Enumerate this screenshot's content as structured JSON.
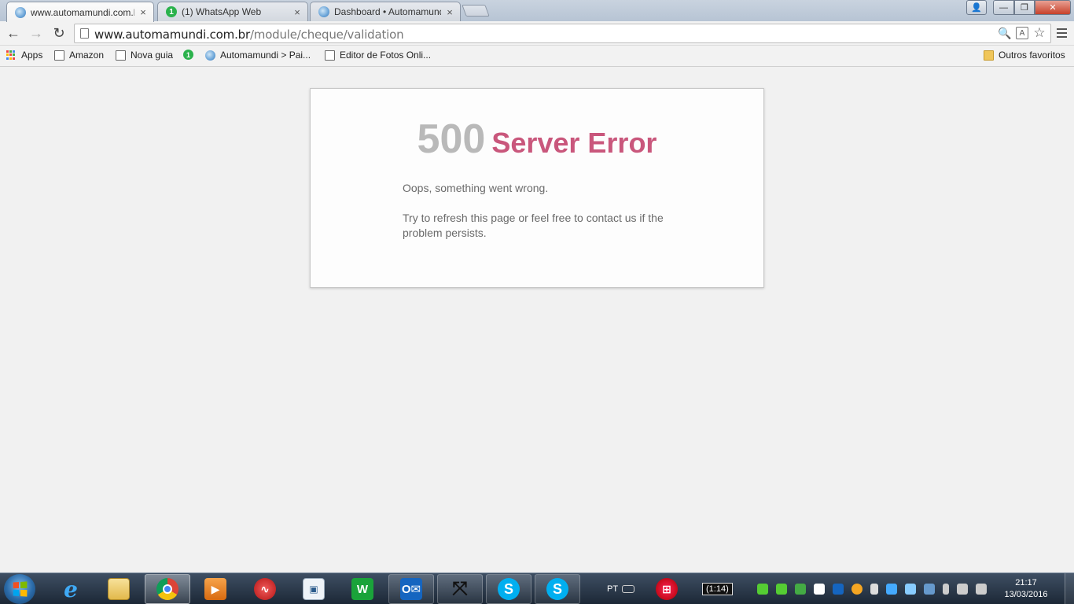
{
  "browser": {
    "tabs": [
      {
        "title": "www.automamundi.com.b",
        "icon": "globe-icon",
        "active": true
      },
      {
        "title": "(1) WhatsApp Web",
        "icon": "whatsapp-icon",
        "badge": "1",
        "active": false
      },
      {
        "title": "Dashboard • Automamund",
        "icon": "globe-icon",
        "active": false
      }
    ],
    "tab_close": "×",
    "window_controls": {
      "minimize": "—",
      "maximize": "❐",
      "close": "✕",
      "user": "👤"
    }
  },
  "toolbar": {
    "back": "←",
    "forward": "→",
    "reload": "↻",
    "url_host": "www.automamundi.com.br",
    "url_path": "/module/cheque/validation",
    "zoom_icon": "🔍",
    "translate_icon": "A",
    "star_icon": "☆"
  },
  "bookmarks": {
    "items": [
      {
        "label": "Apps"
      },
      {
        "label": "Amazon"
      },
      {
        "label": "Nova guia"
      },
      {
        "label": "",
        "badge": "1"
      },
      {
        "label": "Automamundi > Pai..."
      },
      {
        "label": "Editor de Fotos Onli..."
      }
    ],
    "other": "Outros favoritos"
  },
  "error_page": {
    "code": "500",
    "title": "Server Error",
    "message": "Oops, something went wrong.",
    "detail": "Try to refresh this page or feel free to contact us if the problem persists.",
    "code_color": "#b9b9b9",
    "title_color": "#c9577c"
  },
  "taskbar": {
    "apps": [
      "internet-explorer",
      "windows-explorer",
      "chrome",
      "media-player",
      "cardiogram-app",
      "image-viewer",
      "wps-writer",
      "outlook",
      "app-arrows",
      "skype",
      "skype"
    ],
    "language": "PT",
    "battery_indicator": "(1:14)",
    "time": "21:17",
    "date": "13/03/2016"
  }
}
